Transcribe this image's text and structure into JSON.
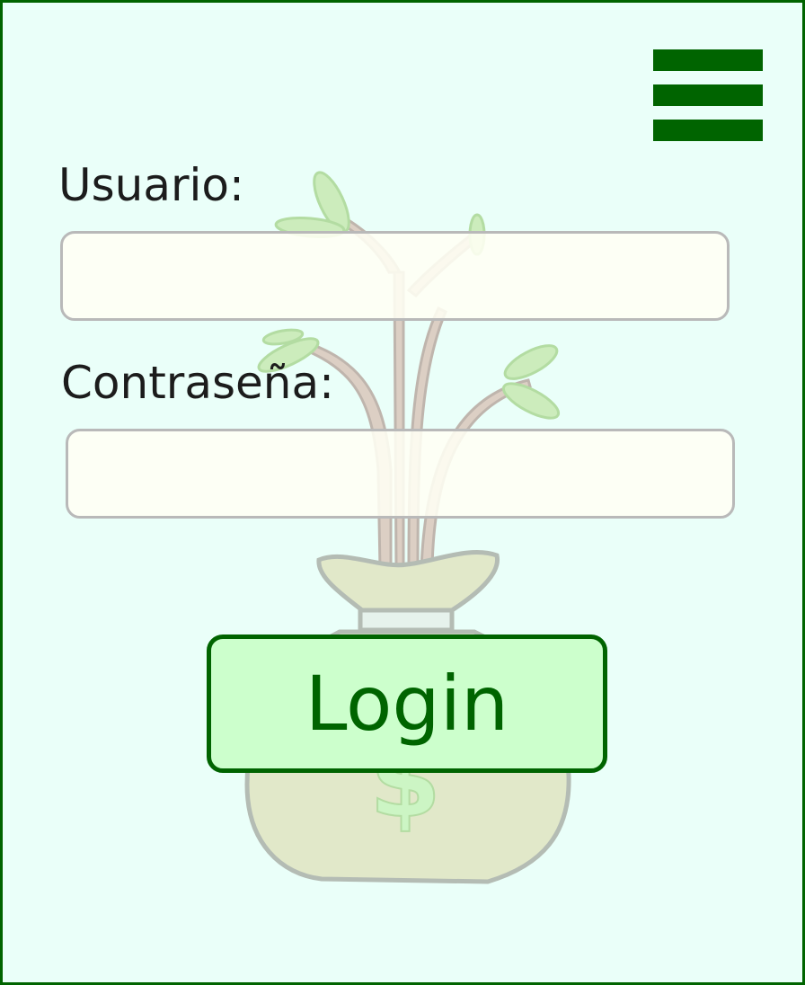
{
  "menu": {
    "icon": "hamburger-menu-icon"
  },
  "form": {
    "username_label": "Usuario:",
    "username_value": "",
    "password_label": "Contraseña:",
    "password_value": "",
    "login_label": "Login"
  },
  "background": {
    "icon": "money-tree-bag-icon",
    "symbol": "$"
  },
  "colors": {
    "accent": "#006400",
    "background": "#eafff9",
    "button_fill": "#ccffcc",
    "field_fill": "#fffff4",
    "field_border": "#b9b9b9"
  }
}
